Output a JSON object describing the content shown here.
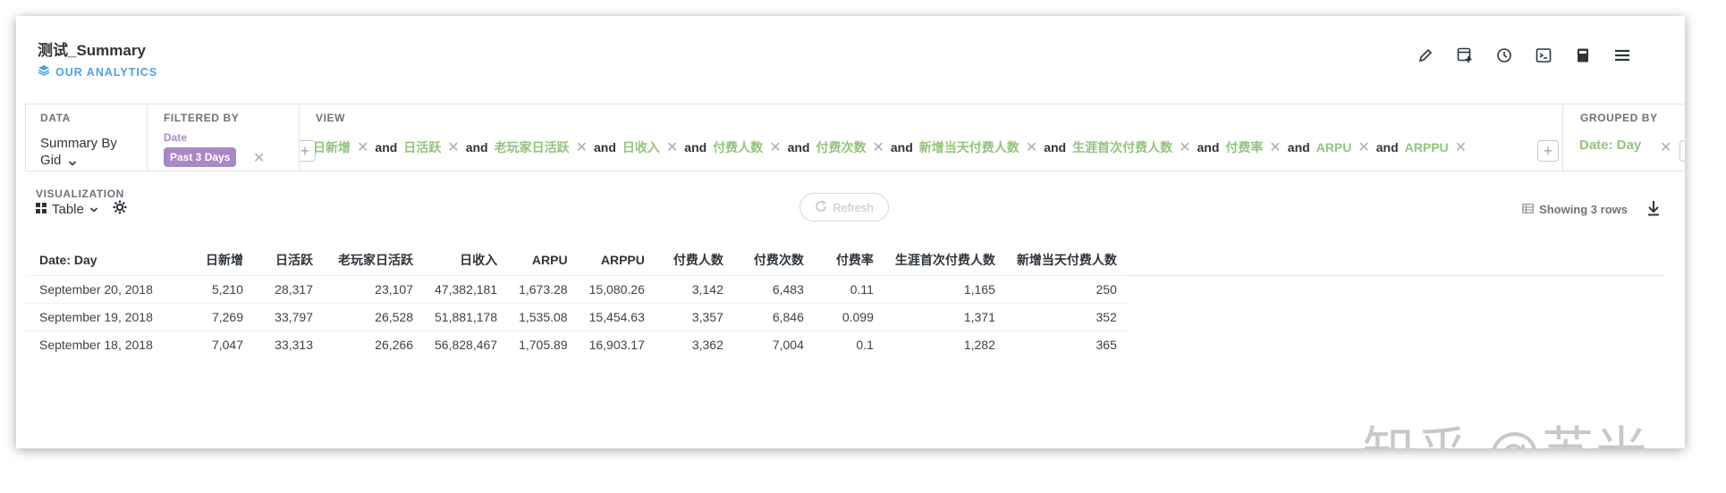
{
  "header": {
    "title": "测试_Summary",
    "collection": "OUR ANALYTICS"
  },
  "toolbar": {
    "icons": [
      "pencil-icon",
      "add-to-dashboard-icon",
      "history-icon",
      "sql-console-icon",
      "bookmark-icon",
      "menu-icon"
    ]
  },
  "query": {
    "data_label": "DATA",
    "data_value": "Summary By Gid",
    "filtered_label": "FILTERED BY",
    "filter_field": "Date",
    "filter_value": "Past 3 Days",
    "view_label": "VIEW",
    "view_metrics": [
      "日新增",
      "日活跃",
      "老玩家日活跃",
      "日收入",
      "付费人数",
      "付费次数",
      "新增当天付费人数",
      "生涯首次付费人数",
      "付费率",
      "ARPU",
      "ARPPU"
    ],
    "and_word": "and",
    "grouped_label": "GROUPED BY",
    "grouped_value": "Date: Day"
  },
  "visualization": {
    "label": "VISUALIZATION",
    "type": "Table"
  },
  "refresh_label": "Refresh",
  "showing": "Showing 3 rows",
  "table": {
    "columns": [
      "Date: Day",
      "日新增",
      "日活跃",
      "老玩家日活跃",
      "日收入",
      "ARPU",
      "ARPPU",
      "付费人数",
      "付费次数",
      "付费率",
      "生涯首次付费人数",
      "新增当天付费人数"
    ],
    "rows": [
      [
        "September 20, 2018",
        "5,210",
        "28,317",
        "23,107",
        "47,382,181",
        "1,673.28",
        "15,080.26",
        "3,142",
        "6,483",
        "0.11",
        "1,165",
        "250"
      ],
      [
        "September 19, 2018",
        "7,269",
        "33,797",
        "26,528",
        "51,881,178",
        "1,535.08",
        "15,454.63",
        "3,357",
        "6,846",
        "0.099",
        "1,371",
        "352"
      ],
      [
        "September 18, 2018",
        "7,047",
        "33,313",
        "26,266",
        "56,828,467",
        "1,705.89",
        "16,903.17",
        "3,362",
        "7,004",
        "0.1",
        "1,282",
        "365"
      ]
    ]
  },
  "watermark": "知乎 @苏米",
  "colors": {
    "brand": "#509ee3",
    "filter": "#a989c5",
    "metric": "#93c47d"
  }
}
